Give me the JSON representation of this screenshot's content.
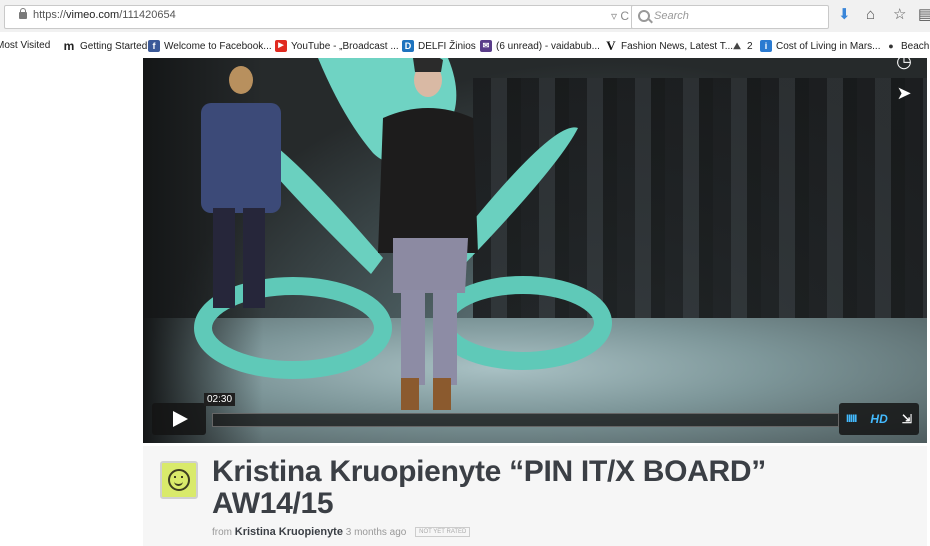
{
  "browser": {
    "url_prefix": "https://",
    "url_domain": "vimeo.com",
    "url_path": "/111420654",
    "search_placeholder": "Search"
  },
  "bookmarks": [
    {
      "label": "Most Visited",
      "icon": "none"
    },
    {
      "label": "Getting Started",
      "icon": "m-logo-icon"
    },
    {
      "label": "Welcome to Facebook...",
      "icon": "facebook-icon"
    },
    {
      "label": "YouTube - „Broadcast ...",
      "icon": "youtube-icon"
    },
    {
      "label": "DELFI Žinios",
      "icon": "delfi-icon"
    },
    {
      "label": "(6 unread) - vaidabub...",
      "icon": "mail-icon"
    },
    {
      "label": "Fashion News, Latest T...",
      "icon": "v-logo-icon"
    },
    {
      "label": "2",
      "icon": "car-icon"
    },
    {
      "label": "Cost of Living in Mars...",
      "icon": "info-icon"
    },
    {
      "label": "Beach",
      "icon": "beach-icon"
    }
  ],
  "player": {
    "timecode": "02:30",
    "hd_label": "HD",
    "progress_fraction": 0.0
  },
  "video": {
    "title": "Kristina Kruopienyte “PIN IT/X BOARD” AW14/15",
    "from_label": "from",
    "author": "Kristina Kruopienyte",
    "time_ago": "3 months ago",
    "rating_badge": "NOT YET RATED"
  },
  "colors": {
    "accent": "#44bbff",
    "avatar_bg": "#d9ea6b",
    "title": "#3b3f45"
  }
}
